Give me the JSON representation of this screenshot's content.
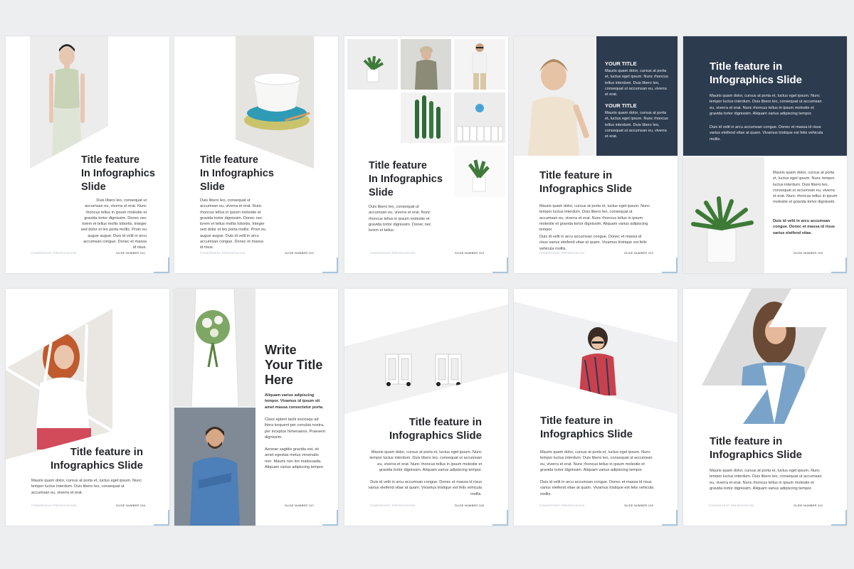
{
  "footer_left": "POWERPOINT PRESENTATION",
  "pages": [
    {
      "title": "Title feature\nIn Infographics\nSlide",
      "body": "Duis libero leo, consequat ut accumsan eu, viverra et erat. Nunc rhoncus tellus in ipsum molestie et gravida tortor dignissim. Donec nec lorem et tellus mollis lobortis. Integer sed dolor et leo porta mollis. Proin eu augue augue. Duis id velit in arcu accumsan congue. Donec et massa id risus.",
      "slide": "SLIDE NUMBER 101"
    },
    {
      "title": "Title feature\nIn Infographics\nSlide",
      "body": "Duis libero leo, consequat ut accumsan eu, viverra et erat. Nunc rhoncus tellus in ipsum molestie et gravida tortor dignissim. Donec nec lorem et tellus mollis lobortis. Integer sed dolor et leo porta mollis. Proin eu augue augue. Duis id velit in arcu accumsan congue. Donec et massa id risus.",
      "slide": "SLIDE NUMBER 102"
    },
    {
      "title": "Title feature\nIn Infographics\nSlide",
      "body": "Duis libero leo, consequat ut accumsan eu, viverra et erat. Nunc rhoncus tellus in ipsum molestie et gravida tortor dignissim. Donec nec lorem et tellus.",
      "slide": "SLIDE NUMBER 103"
    },
    {
      "box1_title": "YOUR TITLE",
      "box1_body": "Mauris quam dolor, cursus at porta et, luctus eget ipsum. Nunc rhoncus tellus interdum. Duis libero leo, consequat ut accumsan eu, viverra et erat.",
      "box2_title": "YOUR TITLE",
      "box2_body": "Mauris quam dolor, cursus at porta et, luctus eget ipsum. Nunc rhoncus tellus interdum. Duis libero leo, consequat ut accumsan eu, viverra et erat.",
      "title": "Title feature in\nInfographics Slide",
      "body": "Mauris quam dolor, cursus at porta et, luctus eget ipsum. Nunc tempor luctus interdum. Duis libero leo, consequat ut accumsan eu, viverra et erat. Nunc rhoncus tellus in ipsum molestie et gravida tortor dignissim. Aliquam varius adipiscing tempor.",
      "body2": "Duis id velit in arcu accumsan congue. Donec et massa id risus varius eleifend vitae at quam. Vivamus tristique est felis vehicula mollis.",
      "slide": "SLIDE NUMBER 104"
    },
    {
      "title": "Title feature in\nInfographics Slide",
      "body": "Mauris quam dolor, cursus at porta et, luctus eget ipsum. Nunc tempor luctus interdum. Duis libero leo, consequat ut accumsan eu, viverra et erat. Nunc rhoncus tellus in ipsum molestie et gravida tortor dignissim. Aliquam varius adipiscing tempor.",
      "body2": "Duis id velit in arcu accumsan congue. Donec et massa id risus varius eleifend vitae at quam. Vivamus tristique est felis vehicula mollis.",
      "side_body": "Mauris quam dolor, cursus at porta et, luctus eget ipsum. Nunc tempor luctus interdum. Duis libero leo, consequat ut accumsan eu, viverra et erat. Nunc rhoncus tellus in ipsum molestie et gravida tortor dignissim.",
      "side_bold": "Duis id velit in arcu accumsan congue. Donec et massa id risus varius eleifend vitae.",
      "slide": "SLIDE NUMBER 105"
    },
    {
      "title": "Title feature in\nInfographics Slide",
      "body": "Mauris quam dolor, cursus at porta et, luctus eget ipsum. Nunc tempor luctus interdum. Duis libero leo, consequat ut accumsan eu, viverra et erat.",
      "slide": "SLIDE NUMBER 106"
    },
    {
      "title": "Write\nYour Title\nHere",
      "bold": "Aliquam varius adipiscing tempor. Vivamus id ipsum sit amet massa consectetur porta.",
      "body": "Class aptent taciti sociosqu ad litora torquent per conubia nostra, per inceptos himenaeos. Praesent dignissim.",
      "body2": "Aenean sagittis gravida est, sit amet egestas metus venenatis non. Mauris non leo malesuada. Aliquam varius adipiscing tempor.",
      "slide": "SLIDE NUMBER 107"
    },
    {
      "title": "Title feature in\nInfographics Slide",
      "body": "Mauris quam dolor, cursus at porta et, luctus eget ipsum. Nunc tempor luctus interdum. Duis libero leo, consequat ut accumsan eu, viverra et erat. Nunc rhoncus tellus in ipsum molestie et gravida tortor dignissim. Aliquam varius adipiscing tempor.",
      "body2": "Duis id velit in arcu accumsan congue. Donec et massa id risus varius eleifend vitae at quam. Vivamus tristique est felis vehicula mollis.",
      "slide": "SLIDE NUMBER 108"
    },
    {
      "title": "Title feature in\nInfographics Slide",
      "body": "Mauris quam dolor, cursus at porta et, luctus eget ipsum. Nunc tempor luctus interdum. Duis libero leo, consequat ut accumsan eu, viverra et erat. Nunc rhoncus tellus in ipsum molestie et gravida tortor dignissim. Aliquam varius adipiscing tempor.",
      "body2": "Duis id velit in arcu accumsan congue. Donec et massa id risus varius eleifend vitae at quam. Vivamus tristique est felis vehicula mollis.",
      "slide": "SLIDE NUMBER 109"
    },
    {
      "title": "Title feature in\nInfographics Slide",
      "body": "Mauris quam dolor, cursus at porta et, luctus eget ipsum. Nunc tempor luctus interdum. Duis libero leo, consequat ut accumsan eu, viverra et erat. Nunc rhoncus tellus in ipsum molestie et gravida tortor dignissim. Aliquam varius adipiscing tempor.",
      "slide": "SLIDE NUMBER 110"
    }
  ]
}
